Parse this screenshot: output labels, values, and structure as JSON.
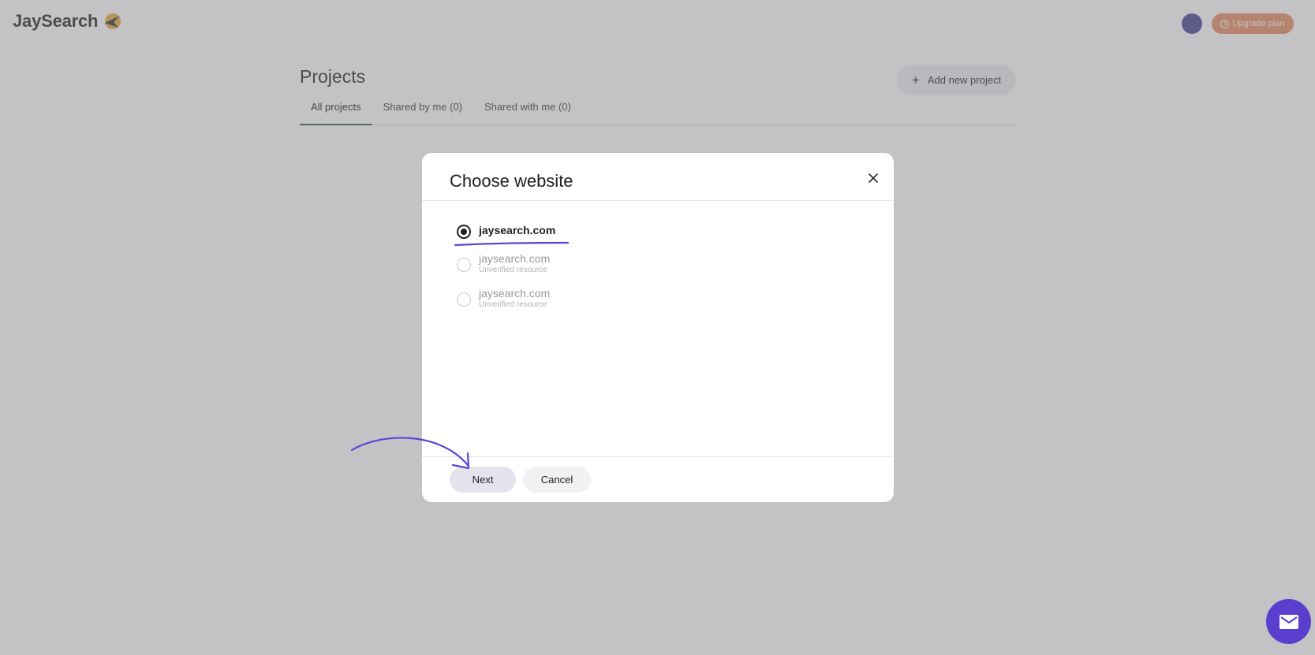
{
  "app": {
    "brand": "JaySearch",
    "upgrade_label": "Upgrade plan"
  },
  "page": {
    "title": "Projects",
    "add_button_label": "Add new project",
    "tabs": [
      {
        "label": "All projects",
        "active": true
      },
      {
        "label": "Shared by me (0)",
        "active": false
      },
      {
        "label": "Shared with me (0)",
        "active": false
      }
    ]
  },
  "modal": {
    "title": "Choose website",
    "options": [
      {
        "name": "jaysearch.com",
        "sub": "",
        "selected": true
      },
      {
        "name": "jaysearch.com",
        "sub": "Unverified resource",
        "selected": false
      },
      {
        "name": "jaysearch.com",
        "sub": "Unverified resource",
        "selected": false
      }
    ],
    "next_label": "Next",
    "cancel_label": "Cancel"
  },
  "colors": {
    "accent": "#5a3fcf",
    "upgrade": "#e7875c",
    "annotation": "#5b45d6"
  },
  "icons": [
    "logo-bird-icon",
    "upgrade-icon",
    "plus-icon",
    "close-icon",
    "mail-icon"
  ]
}
